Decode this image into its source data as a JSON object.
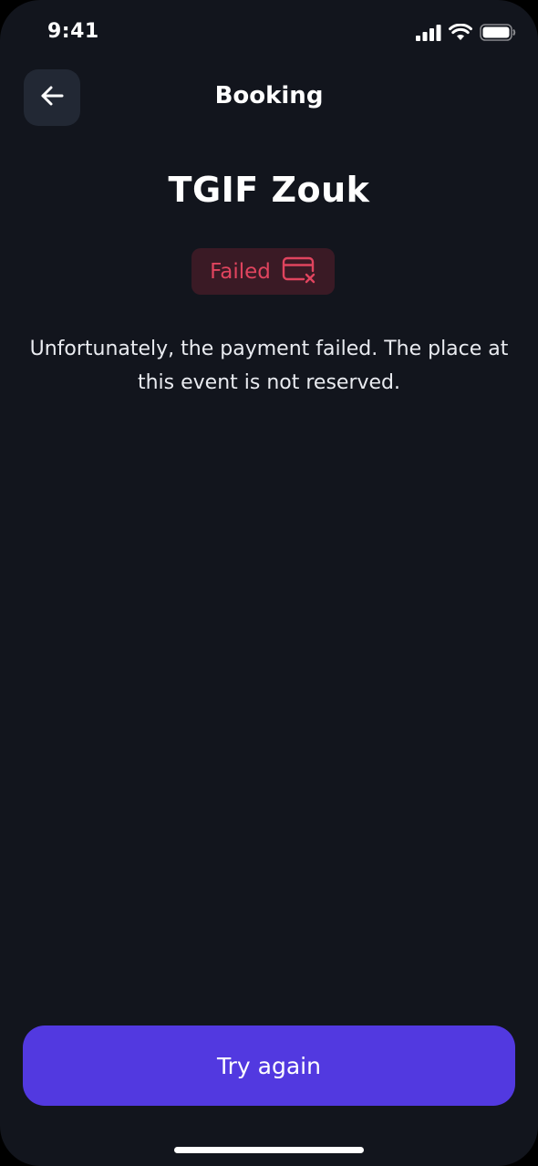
{
  "status_bar": {
    "time": "9:41",
    "icons": [
      "cellular-signal-icon",
      "wifi-icon",
      "battery-icon"
    ]
  },
  "header": {
    "title": "Booking",
    "back_icon": "arrow-left-icon"
  },
  "event": {
    "title": "TGIF Zouk"
  },
  "status_badge": {
    "label": "Failed",
    "icon": "card-failed-icon",
    "text_color": "#e0445e",
    "background_color": "#3a1a25"
  },
  "message": {
    "text": "Unfortunately, the payment failed. The place at this event is not reserved."
  },
  "cta": {
    "label": "Try again",
    "color": "#5239e0"
  },
  "theme": {
    "background": "#12151d",
    "surface": "#222834"
  }
}
